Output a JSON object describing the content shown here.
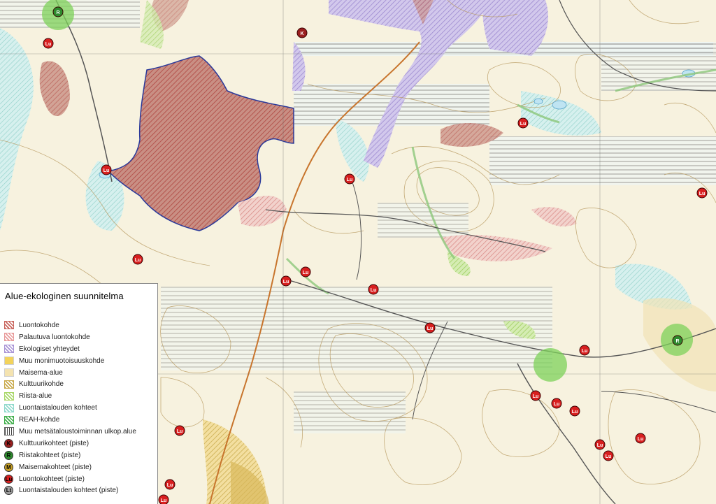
{
  "legend": {
    "title": "Alue-ekologinen suunnitelma",
    "area_items": [
      {
        "label": "Luontokohde",
        "color": "#c9655d",
        "pattern": "hatch"
      },
      {
        "label": "Palautuva luontokohde",
        "color": "#e89a9a",
        "pattern": "hatch"
      },
      {
        "label": "Ekologiset yhteydet",
        "color": "#a994d6",
        "pattern": "hatch"
      },
      {
        "label": "Muu monimuotoisuuskohde",
        "color": "#f2cf4a",
        "pattern": "solid"
      },
      {
        "label": "Maisema-alue",
        "color": "#f3e0a8",
        "pattern": "solid"
      },
      {
        "label": "Kulttuurikohde",
        "color": "#c8a94a",
        "pattern": "hatch"
      },
      {
        "label": "Riista-alue",
        "color": "#a9d86a",
        "pattern": "hatch"
      },
      {
        "label": "Luontaistalouden kohteet",
        "color": "#8fd9cc",
        "pattern": "hatch"
      },
      {
        "label": "REAH-kohde",
        "color": "#3fae4a",
        "pattern": "hatch"
      },
      {
        "label": "Muu metsätaloustoiminnan ulkop.alue",
        "color": "#444444",
        "pattern": "vlines"
      }
    ],
    "point_items": [
      {
        "label": "Kulttuurikohteet (piste)",
        "color": "#9a1f1f",
        "letter": "K"
      },
      {
        "label": "Riistakohteet (piste)",
        "color": "#2e8b2e",
        "letter": "R"
      },
      {
        "label": "Maisemakohteet (piste)",
        "color": "#c9a227",
        "letter": "M"
      },
      {
        "label": "Luontokohteet (piste)",
        "color": "#d81f1f",
        "letter": "Lu"
      },
      {
        "label": "Luontaistalouden kohteet (piste)",
        "color": "#9e9e9e",
        "letter": "Lt"
      }
    ]
  },
  "map": {
    "point_markers": [
      {
        "type": "Riistakohteet",
        "letter": "R"
      },
      {
        "type": "Riistakohteet",
        "letter": "R"
      },
      {
        "type": "Kulttuurikohteet",
        "letter": "K"
      },
      {
        "type": "Luontokohteet",
        "letter": "Lu"
      }
    ]
  }
}
